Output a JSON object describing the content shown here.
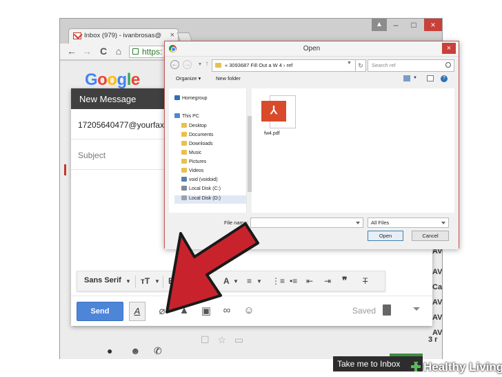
{
  "browser": {
    "tab_title": "Inbox (979) - ivanbrosas@",
    "url_text": "https:",
    "tab_close": "×",
    "user_glyph": "▲",
    "min_glyph": "–",
    "max_glyph": "□",
    "close_glyph": "×",
    "nav": {
      "back": "←",
      "forward": "→",
      "reload": "C",
      "home": "⌂"
    }
  },
  "gmail": {
    "logo": "Google",
    "logo_colors": [
      "#4285f4",
      "#ea4335",
      "#fbbc05",
      "#4285f4",
      "#34a853",
      "#ea4335"
    ],
    "compose": {
      "title": "New Message",
      "to_value": "17205640477@yourfax",
      "subject_placeholder": "Subject",
      "format_font": "Sans Serif",
      "send_label": "Send",
      "format_toggle": "A",
      "saved_label": "Saved"
    },
    "take_me_to_inbox": "Take me to Inbox",
    "take_me_close": "×",
    "side_fragments": [
      "AV",
      "AV",
      "Ca",
      "AV",
      "AV",
      "AV",
      "3 r"
    ]
  },
  "dialog": {
    "title": "Open",
    "close_glyph": "×",
    "breadcrumb": "«  3093687 Fill Out a W 4  ›  ref",
    "search_placeholder": "Search ref",
    "organize_label": "Organize ▾",
    "new_folder_label": "New folder",
    "nav_items": [
      {
        "label": "Homegroup",
        "icon_color": "#2f6fb5"
      },
      {
        "label": "This PC",
        "icon_color": "#4a8ad4"
      },
      {
        "label": "Desktop",
        "icon_color": "#e7c14f"
      },
      {
        "label": "Documents",
        "icon_color": "#e7c14f"
      },
      {
        "label": "Downloads",
        "icon_color": "#e7c14f"
      },
      {
        "label": "Music",
        "icon_color": "#e7c14f"
      },
      {
        "label": "Pictures",
        "icon_color": "#e7c14f"
      },
      {
        "label": "Videos",
        "icon_color": "#e7c14f"
      },
      {
        "label": "void (voidoid)",
        "icon_color": "#5b7fa8"
      },
      {
        "label": "Local Disk (C:)",
        "icon_color": "#7e8a96"
      },
      {
        "label": "Local Disk (D:)",
        "icon_color": "#9aa3ac"
      }
    ],
    "file": {
      "name": "fw4.pdf"
    },
    "filename_label": "File name:",
    "filetype_value": "All Files",
    "open_label": "Open",
    "cancel_label": "Cancel"
  },
  "watermark": "Healthy Living",
  "colors": {
    "accent_send": "#4d85d9",
    "arrow_red": "#c8232c",
    "pdf_red": "#d94a2b"
  }
}
